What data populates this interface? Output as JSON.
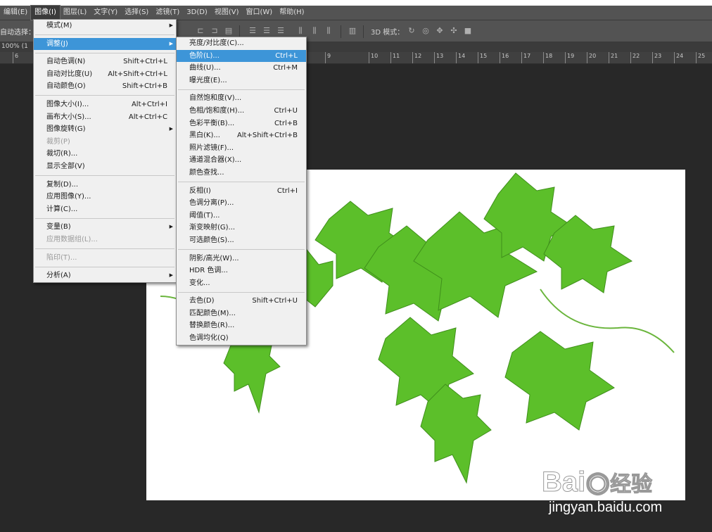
{
  "menubar": {
    "items": [
      "编辑(E)",
      "图像(I)",
      "图层(L)",
      "文字(Y)",
      "选择(S)",
      "滤镜(T)",
      "3D(D)",
      "视图(V)",
      "窗口(W)",
      "帮助(H)"
    ],
    "active_index": 1
  },
  "optionsbar": {
    "auto_select_label": "自动选择：",
    "mode_3d_label": "3D 模式："
  },
  "document_tab": {
    "label": "100% (1"
  },
  "ruler": {
    "ticks": [
      "6",
      "9",
      "10",
      "11",
      "12",
      "13",
      "14",
      "15",
      "16",
      "17",
      "18",
      "19",
      "20",
      "21",
      "22",
      "23",
      "24",
      "25"
    ]
  },
  "image_menu": {
    "groups": [
      [
        {
          "label": "模式(M)",
          "shortcut": "",
          "submenu": true
        }
      ],
      [
        {
          "label": "调整(J)",
          "shortcut": "",
          "submenu": true,
          "highlighted": true
        }
      ],
      [
        {
          "label": "自动色调(N)",
          "shortcut": "Shift+Ctrl+L"
        },
        {
          "label": "自动对比度(U)",
          "shortcut": "Alt+Shift+Ctrl+L"
        },
        {
          "label": "自动颜色(O)",
          "shortcut": "Shift+Ctrl+B"
        }
      ],
      [
        {
          "label": "图像大小(I)...",
          "shortcut": "Alt+Ctrl+I"
        },
        {
          "label": "画布大小(S)...",
          "shortcut": "Alt+Ctrl+C"
        },
        {
          "label": "图像旋转(G)",
          "shortcut": "",
          "submenu": true
        },
        {
          "label": "裁剪(P)",
          "shortcut": "",
          "disabled": true
        },
        {
          "label": "裁切(R)...",
          "shortcut": ""
        },
        {
          "label": "显示全部(V)",
          "shortcut": ""
        }
      ],
      [
        {
          "label": "复制(D)...",
          "shortcut": ""
        },
        {
          "label": "应用图像(Y)...",
          "shortcut": ""
        },
        {
          "label": "计算(C)...",
          "shortcut": ""
        }
      ],
      [
        {
          "label": "变量(B)",
          "shortcut": "",
          "submenu": true
        },
        {
          "label": "应用数据组(L)...",
          "shortcut": "",
          "disabled": true
        }
      ],
      [
        {
          "label": "陷印(T)...",
          "shortcut": "",
          "disabled": true
        }
      ],
      [
        {
          "label": "分析(A)",
          "shortcut": "",
          "submenu": true
        }
      ]
    ]
  },
  "adjust_menu": {
    "groups": [
      [
        {
          "label": "亮度/对比度(C)...",
          "shortcut": ""
        },
        {
          "label": "色阶(L)...",
          "shortcut": "Ctrl+L",
          "highlighted": true
        },
        {
          "label": "曲线(U)...",
          "shortcut": "Ctrl+M"
        },
        {
          "label": "曝光度(E)...",
          "shortcut": ""
        }
      ],
      [
        {
          "label": "自然饱和度(V)...",
          "shortcut": ""
        },
        {
          "label": "色相/饱和度(H)...",
          "shortcut": "Ctrl+U"
        },
        {
          "label": "色彩平衡(B)...",
          "shortcut": "Ctrl+B"
        },
        {
          "label": "黑白(K)...",
          "shortcut": "Alt+Shift+Ctrl+B"
        },
        {
          "label": "照片滤镜(F)...",
          "shortcut": ""
        },
        {
          "label": "通道混合器(X)...",
          "shortcut": ""
        },
        {
          "label": "颜色查找...",
          "shortcut": ""
        }
      ],
      [
        {
          "label": "反相(I)",
          "shortcut": "Ctrl+I"
        },
        {
          "label": "色调分离(P)...",
          "shortcut": ""
        },
        {
          "label": "阈值(T)...",
          "shortcut": ""
        },
        {
          "label": "渐变映射(G)...",
          "shortcut": ""
        },
        {
          "label": "可选颜色(S)...",
          "shortcut": ""
        }
      ],
      [
        {
          "label": "阴影/高光(W)...",
          "shortcut": ""
        },
        {
          "label": "HDR 色调...",
          "shortcut": ""
        },
        {
          "label": "变化...",
          "shortcut": ""
        }
      ],
      [
        {
          "label": "去色(D)",
          "shortcut": "Shift+Ctrl+U"
        },
        {
          "label": "匹配颜色(M)...",
          "shortcut": ""
        },
        {
          "label": "替换颜色(R)...",
          "shortcut": ""
        },
        {
          "label": "色调均化(Q)",
          "shortcut": ""
        }
      ]
    ]
  },
  "watermark": {
    "brand": "Bai",
    "brand2": "经验",
    "url": "jingyan.baidu.com"
  },
  "colors": {
    "ui_dark": "#282828",
    "menubar": "#535353",
    "highlight": "#3d95d8",
    "leaf": "#5cbf2a"
  }
}
